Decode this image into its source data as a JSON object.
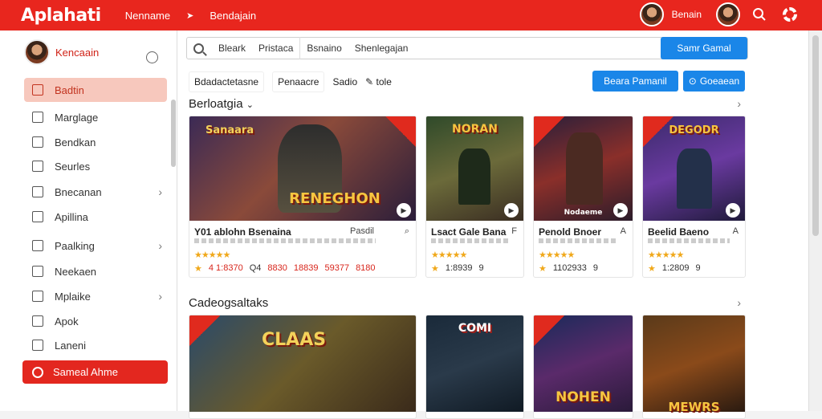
{
  "app": {
    "title": "Aplahati"
  },
  "topnav": {
    "item1": "Nenname",
    "arrow": "➤",
    "item2": "Bendajain"
  },
  "topright": {
    "user": "Benain"
  },
  "sidebar": {
    "user_name": "Kencaain",
    "items": [
      {
        "label": "Badtin"
      },
      {
        "label": "Marglage"
      },
      {
        "label": "Bendkan"
      },
      {
        "label": "Seurles"
      },
      {
        "label": "Bnecanan"
      },
      {
        "label": "Apillina"
      },
      {
        "label": "Paalking"
      },
      {
        "label": "Neekaen"
      },
      {
        "label": "Mplaike"
      },
      {
        "label": "Apok"
      },
      {
        "label": "Laneni"
      }
    ],
    "cta": "Sameal Ahme"
  },
  "search": {
    "seg1": "Bleark",
    "seg2": "Pristaca",
    "seg3": "Bsnaino",
    "seg4": "Shenlegajan",
    "button": "Samr Gamal"
  },
  "filters": {
    "chip1": "Bdadactetasne",
    "chip2": "Penaacre",
    "chip3": "Sadio",
    "chip4": "tole",
    "btn1": "Beara Pamanil",
    "btn2": "Goeaean"
  },
  "section1": {
    "title": "Berloatgia",
    "cards": [
      {
        "art": "RENEGHON",
        "corner_art": "Sanaara",
        "title": "Y01 ablohn Bsenaina",
        "t2": "Pasdil",
        "meta": [
          "4 1:8370",
          "Q4",
          "8830",
          "18839",
          "59377",
          "8180"
        ]
      },
      {
        "art": "NORAN",
        "title": "Lsact Gale Bana",
        "t2": "F",
        "meta": [
          "1:8939",
          "9"
        ]
      },
      {
        "art": "Nodaeme",
        "title": "Penold Bnoer",
        "t2": "A",
        "meta": [
          "1102933",
          "9"
        ]
      },
      {
        "art": "DEGODR",
        "title": "Beelid Baeno",
        "t2": "A",
        "meta": [
          "1:2809",
          "9"
        ]
      }
    ]
  },
  "section2": {
    "title": "Cadeogsaltaks",
    "cards": [
      {
        "art": "CLAAS"
      },
      {
        "art": "COMI"
      },
      {
        "art": "NOHEN"
      },
      {
        "art": "MEWRS"
      }
    ]
  },
  "colors": {
    "brand_red": "#e8261e",
    "accent_blue": "#1a86e8",
    "star": "#f0a81a"
  },
  "icons": [
    "gear-icon",
    "search-icon",
    "star-icon",
    "chevron-right-icon",
    "play-icon"
  ]
}
